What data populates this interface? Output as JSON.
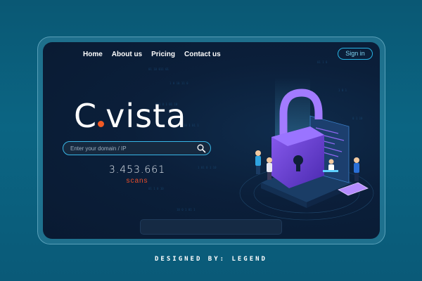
{
  "nav": {
    "items": [
      "Home",
      "About us",
      "Pricing",
      "Contact us"
    ],
    "signin_label": "Sign in"
  },
  "brand": {
    "logo_left": "C",
    "logo_right": "vista",
    "accent": "#f15a24"
  },
  "search": {
    "placeholder": "Enter your domain / IP",
    "icon": "search-icon"
  },
  "stats": {
    "count": "3.453.661",
    "label": "scans"
  },
  "footer": {
    "credit": "DESIGNED BY: LEGEND"
  },
  "colors": {
    "primary": "#27b4e5",
    "background": "#0b1f3a",
    "lock": "#6c3fd0"
  }
}
